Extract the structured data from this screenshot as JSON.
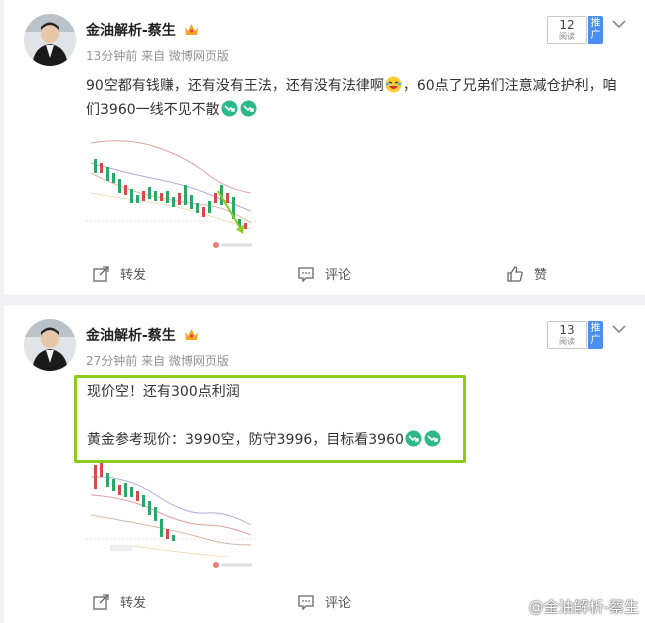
{
  "posts": [
    {
      "author": "金油解析-蔡生",
      "meta": "13分钟前  来自 微博网页版",
      "read_count": "12",
      "read_label": "阅读",
      "promote_label": "推广",
      "text_before_emoji": "90空都有钱赚，还有没有王法，还有没有法律啊",
      "text_after_emoji": "，60点了兄弟们注意减仓护利，咱们3960一线不见不散",
      "actions": {
        "repost": "转发",
        "comment": "评论",
        "like": "赞"
      }
    },
    {
      "author": "金油解析-蔡生",
      "meta": "27分钟前  来自 微博网页版",
      "read_count": "13",
      "read_label": "阅读",
      "promote_label": "推广",
      "line1": "现价空！还有300点利润",
      "line2": "黄金参考现价：3990空，防守3996，目标看3960",
      "actions": {
        "repost": "转发",
        "comment": "评论"
      }
    }
  ],
  "watermark": "@金油解析-蔡生",
  "colors": {
    "accent": "#4a8ff0",
    "highlight_border": "#8fcb1e",
    "emoji_green": "#2db88a"
  }
}
